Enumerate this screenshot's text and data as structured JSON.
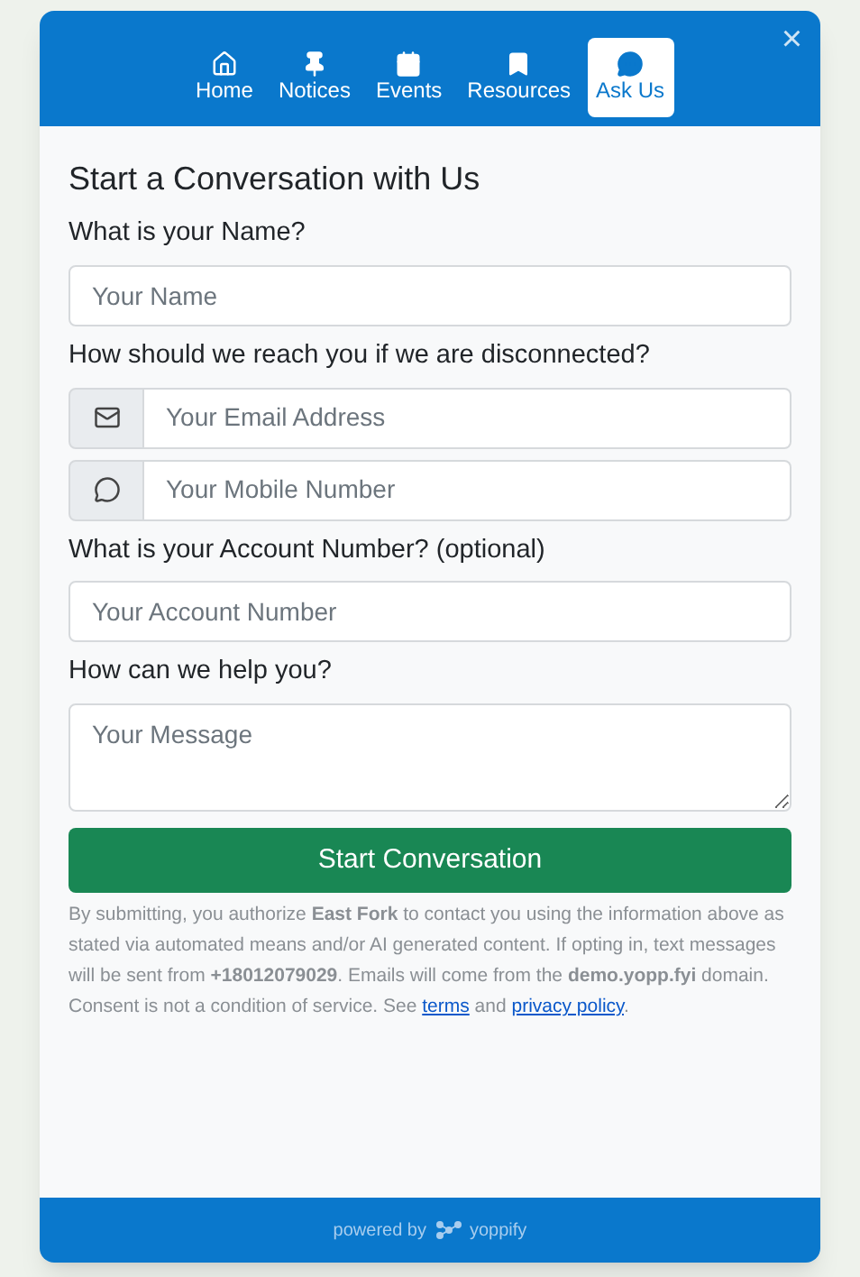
{
  "tabs": [
    {
      "label": "Home",
      "selected": false
    },
    {
      "label": "Notices",
      "selected": false
    },
    {
      "label": "Events",
      "selected": false
    },
    {
      "label": "Resources",
      "selected": false
    },
    {
      "label": "Ask Us",
      "selected": true
    }
  ],
  "close": "×",
  "form": {
    "title": "Start a Conversation with Us",
    "groups": [
      {
        "label": "What is your Name?",
        "fields": [
          {
            "kind": "text",
            "placeholder": "Your Name"
          }
        ]
      },
      {
        "label": "How should we reach you if we are disconnected?",
        "fields": [
          {
            "kind": "email",
            "placeholder": "Your Email Address"
          },
          {
            "kind": "phone",
            "placeholder": "Your Mobile Number"
          }
        ]
      },
      {
        "label": "What is your Account Number? (optional)",
        "fields": [
          {
            "kind": "text",
            "placeholder": "Your Account Number"
          }
        ]
      },
      {
        "label": "How can we help you?",
        "fields": [
          {
            "kind": "textarea",
            "placeholder": "Your Message"
          }
        ]
      }
    ],
    "submit": "Start Conversation",
    "consent": {
      "text": "By submitting, you authorize **East Fork** to contact you using the information above as stated via automated means and/or AI generated content. If opting in, text messages will be sent from **+18012079029**. Emails will come from the **demo.yopp.fyi** domain. Consent is not a condition of service. See",
      "links": [
        "terms",
        "privacy policy"
      ],
      "joiner": "and",
      "end": "."
    }
  },
  "footer": {
    "prefix": "powered by",
    "brand": "yoppify"
  }
}
